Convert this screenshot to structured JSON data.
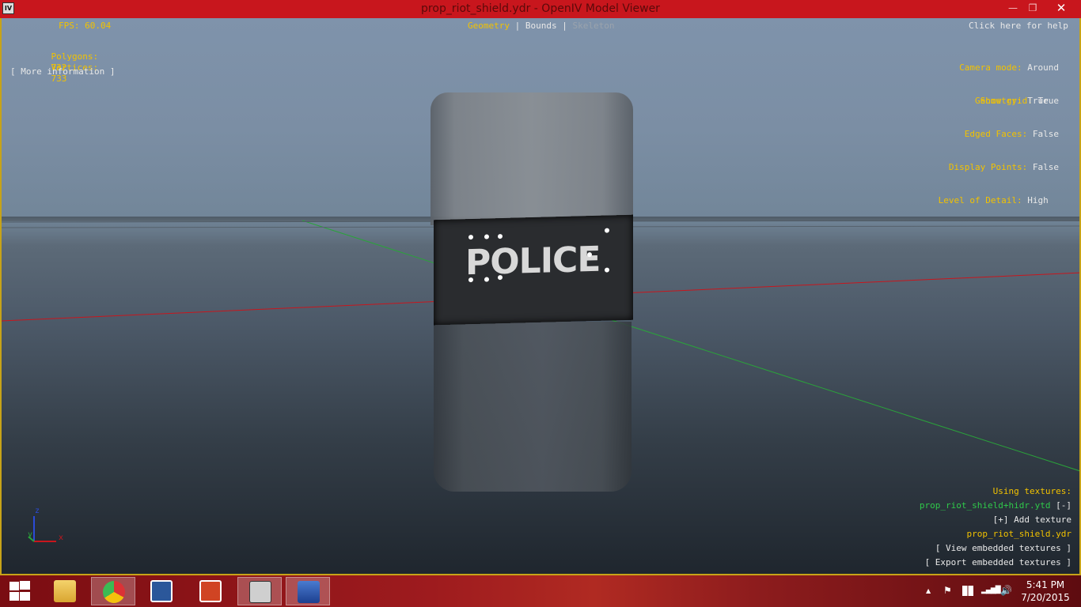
{
  "window": {
    "icon_text": "IV",
    "title": "prop_riot_shield.ydr - OpenIV Model Viewer",
    "minimize_glyph": "—",
    "maximize_glyph": "❐",
    "close_glyph": "✕"
  },
  "hud": {
    "fps": "FPS: 60.04",
    "polygons_label": "Polygons:",
    "polygons_value": "732",
    "vertices_label": "Vertices:",
    "vertices_value": "733",
    "more_information": "[ More information ]",
    "tab_geometry": "Geometry",
    "tab_sep1": " | ",
    "tab_bounds": "Bounds",
    "tab_sep2": " | ",
    "tab_skeleton": "Skeleton",
    "help": "Click here for help",
    "camera_mode_label": "Camera mode:",
    "camera_mode_value": "Around",
    "show_grid_label": "Show grid:",
    "show_grid_value": "True",
    "geometry_label": "Geometry:",
    "geometry_value": "True",
    "edged_faces_label": "Edged Faces:",
    "edged_faces_value": "False",
    "display_points_label": "Display Points:",
    "display_points_value": "False",
    "lod_label": "Level of Detail:",
    "lod_value": "High"
  },
  "textures": {
    "heading": "Using textures:",
    "texture_file": "prop_riot_shield+hidr.ytd",
    "collapse": "[-]",
    "add_texture": "[+] Add texture",
    "embedded_file": "prop_riot_shield.ydr",
    "view_embedded": "[ View embedded textures ]",
    "export_embedded": "[ Export embedded textures ]"
  },
  "model": {
    "shield_text": "POLICE"
  },
  "gizmo": {
    "z": "z",
    "y": "y",
    "x": "x"
  },
  "taskbar": {
    "apps": [
      "start-icon",
      "file-explorer-icon",
      "chrome-icon",
      "word-icon",
      "powerpoint-icon",
      "openiv-icon",
      "remote-desktop-icon"
    ],
    "tray_up": "▲",
    "tray_flag": "⚑",
    "tray_network": "▂▄▆█",
    "tray_volume": "🔊",
    "time": "5:41 PM",
    "date": "7/20/2015"
  },
  "colors": {
    "titlebar": "#c8161d",
    "hud_label": "#f2c200",
    "hud_value": "#e8e8e8",
    "texture_file": "#2fc94a",
    "axis_x": "#c8161d",
    "axis_y": "#2aa33a",
    "axis_z": "#2b4bd6"
  }
}
